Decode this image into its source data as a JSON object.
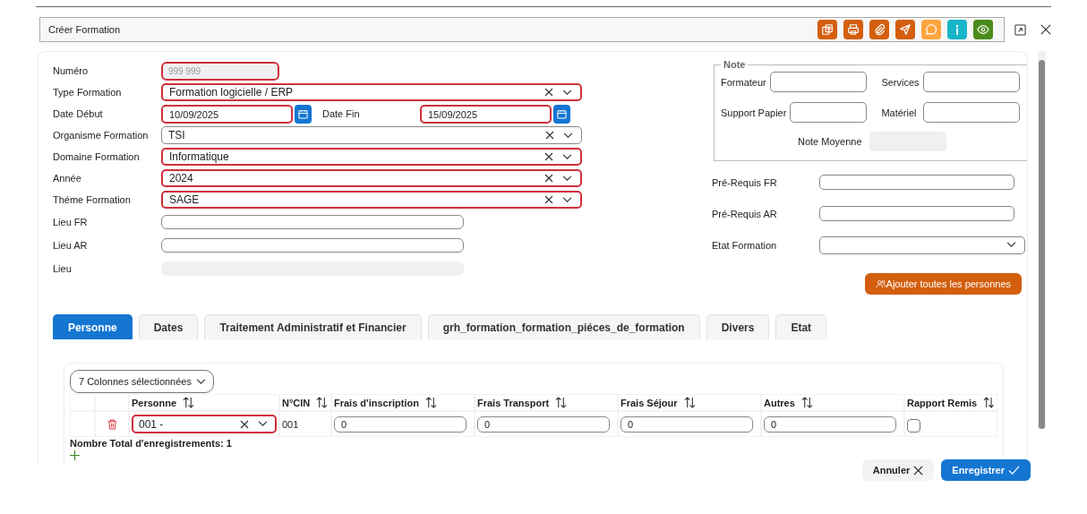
{
  "window": {
    "title": "Créer Formation"
  },
  "toolbar": [
    {
      "kind": "documents",
      "color": "#d35f0e"
    },
    {
      "kind": "print",
      "color": "#d35f0e"
    },
    {
      "kind": "attach",
      "color": "#d35f0e"
    },
    {
      "kind": "send",
      "color": "#d35f0e"
    },
    {
      "kind": "comment",
      "color": "#ffa53f"
    },
    {
      "kind": "info",
      "color": "#18b4c8"
    },
    {
      "kind": "view",
      "color": "#4b8b1b"
    }
  ],
  "left_fields": [
    {
      "kind": "number",
      "label": "Numéro",
      "placeholder": "999 999",
      "error": true,
      "disabled": true
    },
    {
      "kind": "select",
      "label": "Type Formation",
      "value": "Formation logicielle / ERP",
      "error": true
    },
    {
      "kind": "dates",
      "label": "Date Début",
      "value": "10/09/2025",
      "error": true,
      "label_2": "Date Fin",
      "value_2": "15/09/2025",
      "error_2": true
    },
    {
      "kind": "select",
      "label": "Organisme Formation",
      "value": "TSI",
      "error": false
    },
    {
      "kind": "select",
      "label": "Domaine Formation",
      "value": "Informatique",
      "error": true
    },
    {
      "kind": "select",
      "label": "Année",
      "value": "2024",
      "error": true
    },
    {
      "kind": "select",
      "label": "Théme Formation",
      "value": "SAGE",
      "error": true
    },
    {
      "kind": "text",
      "label": "Lieu FR",
      "error": false,
      "disabled": false
    },
    {
      "kind": "text",
      "label": "Lieu AR",
      "error": false,
      "disabled": false
    },
    {
      "kind": "text",
      "label": "Lieu",
      "error": false,
      "disabled": true
    }
  ],
  "note": {
    "legend": "Note",
    "fields": [
      {
        "label": "Formateur"
      },
      {
        "label": "Services"
      },
      {
        "label": "Support Papier"
      },
      {
        "label": "Matériel"
      }
    ],
    "average_label": "Note Moyenne"
  },
  "right_fields": [
    {
      "kind": "text",
      "label": "Pré-Requis FR"
    },
    {
      "kind": "text",
      "label": "Pré-Requis AR"
    },
    {
      "kind": "select",
      "label": "Etat Formation"
    }
  ],
  "add_all_button": "Ajouter toutes les personnes",
  "tabs": [
    {
      "label": "Personne",
      "selected": true
    },
    {
      "label": "Dates",
      "selected": false
    },
    {
      "label": "Traitement Administratif et Financier",
      "selected": false
    },
    {
      "label": "grh_formation_formation_piéces_de_formation",
      "selected": false
    },
    {
      "label": "Divers",
      "selected": false
    },
    {
      "label": "Etat",
      "selected": false
    }
  ],
  "grid": {
    "column_picker": "7 Colonnes sélectionnées",
    "columns": [
      "Personne",
      "N°CIN",
      "Frais d'inscription",
      "Frais Transport",
      "Frais Séjour",
      "Autres",
      "Rapport Remis"
    ],
    "rows": [
      {
        "personne": "001 -",
        "error": true,
        "cin": "001",
        "amounts": [
          "0",
          "0",
          "0",
          "0"
        ],
        "rapport_remis": false
      }
    ],
    "total": "Nombre Total d'enregistrements: 1"
  },
  "buttons": {
    "cancel": "Annuler",
    "save": "Enregistrer"
  }
}
